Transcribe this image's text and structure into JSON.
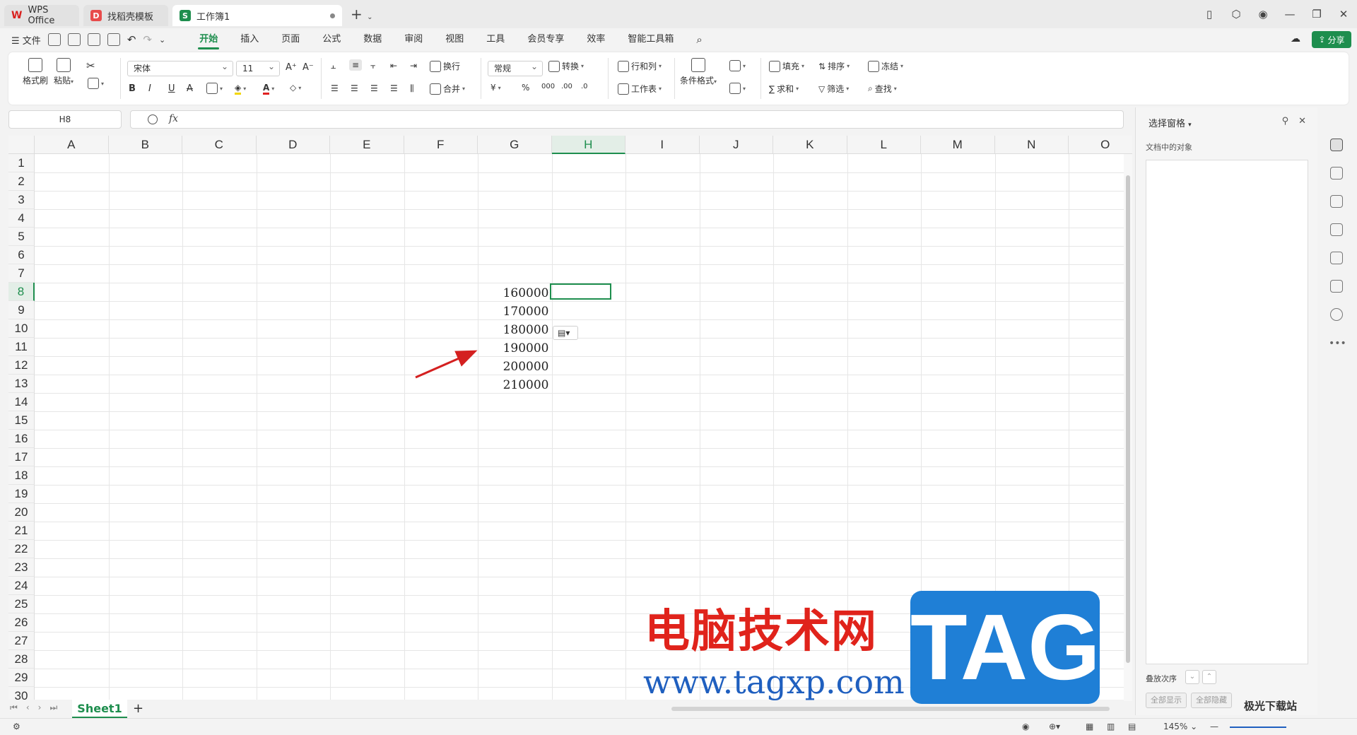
{
  "tabs": [
    {
      "label": "WPS Office"
    },
    {
      "label": "找稻壳模板"
    },
    {
      "label": "工作簿1"
    }
  ],
  "menu": {
    "file": "文件",
    "tabs": [
      "开始",
      "插入",
      "页面",
      "公式",
      "数据",
      "审阅",
      "视图",
      "工具",
      "会员专享",
      "效率",
      "智能工具箱"
    ],
    "active_tab": "开始",
    "share": "分享"
  },
  "ribbon": {
    "format_painter": "格式刷",
    "paste": "粘贴",
    "font_name": "宋体",
    "font_size": "11",
    "wrap": "换行",
    "merge": "合并",
    "number_format": "常规",
    "convert": "转换",
    "row_col": "行和列",
    "worksheet": "工作表",
    "conditional": "条件格式",
    "fill": "填充",
    "sort": "排序",
    "freeze": "冻结",
    "sum": "求和",
    "filter": "筛选",
    "find": "查找",
    "bold": "B",
    "italic": "I",
    "underline": "U",
    "currency": "¥",
    "percent": "%"
  },
  "formula": {
    "name_box": "H8",
    "fx": "fx",
    "content": ""
  },
  "columns": [
    "A",
    "B",
    "C",
    "D",
    "E",
    "F",
    "G",
    "H",
    "I",
    "J",
    "K",
    "L",
    "M",
    "N",
    "O"
  ],
  "rows": [
    "1",
    "2",
    "3",
    "4",
    "5",
    "6",
    "7",
    "8",
    "9",
    "10",
    "11",
    "12",
    "13",
    "14",
    "15",
    "16",
    "17",
    "18",
    "19",
    "20",
    "21",
    "22",
    "23",
    "24",
    "25",
    "26",
    "27",
    "28",
    "29",
    "30"
  ],
  "selected": {
    "column": "H",
    "row": "8"
  },
  "cells": [
    {
      "ref": "G8",
      "value": "160000"
    },
    {
      "ref": "G9",
      "value": "170000"
    },
    {
      "ref": "G10",
      "value": "180000"
    },
    {
      "ref": "G11",
      "value": "190000"
    },
    {
      "ref": "G12",
      "value": "200000"
    },
    {
      "ref": "G13",
      "value": "210000"
    }
  ],
  "sheets": {
    "active": "Sheet1",
    "add": "+"
  },
  "status": {
    "zoom": "145%"
  },
  "pane": {
    "title": "选择窗格",
    "subtitle": "文档中的对象",
    "order_label": "叠放次序",
    "show_all": "全部显示",
    "hide_all": "全部隐藏"
  },
  "watermark": {
    "cn": "电脑技术网",
    "url": "www.tagxp.com",
    "tag": "TAG",
    "site": "极光下载站"
  },
  "colors": {
    "accent": "#1e8e4e",
    "arrow": "#d42020"
  }
}
